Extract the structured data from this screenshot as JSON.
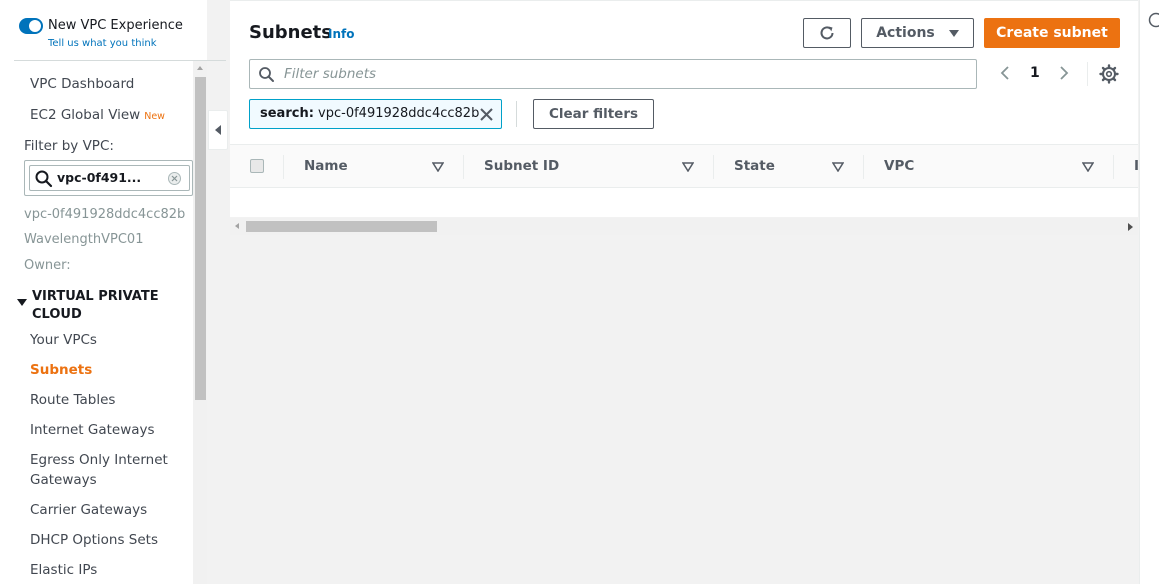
{
  "vpc_experience": {
    "title": "New VPC Experience",
    "feedback_link": "Tell us what you think"
  },
  "sidebar": {
    "top_links": [
      {
        "label": "VPC Dashboard"
      },
      {
        "label": "EC2 Global View",
        "badge": "New"
      }
    ],
    "filter_label": "Filter by VPC:",
    "vpc_filter_value": "vpc-0f491...",
    "vpc_id": "vpc-0f491928ddc4cc82b",
    "vpc_name": "WavelengthVPC01",
    "owner_label": "Owner:",
    "section_title": "VIRTUAL PRIVATE CLOUD",
    "items": [
      {
        "label": "Your VPCs"
      },
      {
        "label": "Subnets",
        "active": true
      },
      {
        "label": "Route Tables"
      },
      {
        "label": "Internet Gateways"
      },
      {
        "label": "Egress Only Internet Gateways"
      },
      {
        "label": "Carrier Gateways"
      },
      {
        "label": "DHCP Options Sets"
      },
      {
        "label": "Elastic IPs"
      }
    ]
  },
  "main": {
    "title": "Subnets",
    "info_link": "Info",
    "actions_label": "Actions",
    "create_label": "Create subnet",
    "filter_placeholder": "Filter subnets",
    "page_number": "1",
    "token": {
      "key": "search:",
      "value": "vpc-0f491928ddc4cc82b"
    },
    "clear_filters_label": "Clear filters",
    "columns": [
      "Name",
      "Subnet ID",
      "State",
      "VPC",
      "I"
    ]
  },
  "colors": {
    "accent": "#ec7211",
    "link": "#0073bb",
    "token_border": "#00a1c9"
  },
  "icons": [
    "toggle-on-icon",
    "search-icon",
    "clear-icon",
    "refresh-icon",
    "caret-down-icon",
    "chevron-left-icon",
    "chevron-right-icon",
    "gear-icon",
    "close-icon",
    "sort-down-icon",
    "help-icon"
  ]
}
